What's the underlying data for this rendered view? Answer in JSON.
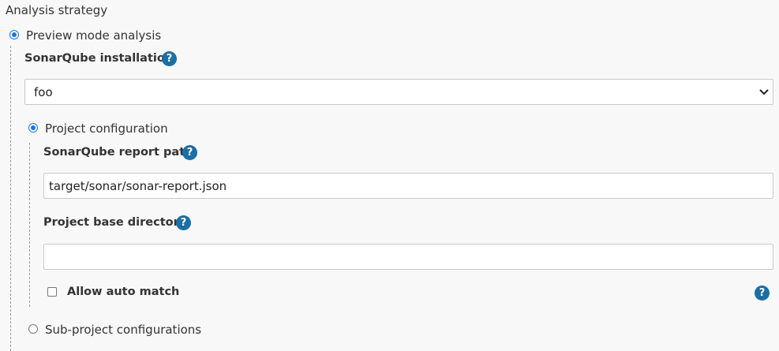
{
  "section_title": "Analysis strategy",
  "preview_mode": {
    "label": "Preview mode analysis",
    "checked": true
  },
  "sonarqube_installation": {
    "label": "SonarQube installation",
    "help": "?",
    "selected": "foo"
  },
  "project_configuration": {
    "label": "Project configuration",
    "checked": true
  },
  "report_path": {
    "label": "SonarQube report path",
    "help": "?",
    "value": "target/sonar/sonar-report.json"
  },
  "base_directory": {
    "label": "Project base directory",
    "help": "?",
    "value": ""
  },
  "auto_match": {
    "label": "Allow auto match",
    "checked": false,
    "help": "?"
  },
  "sub_project": {
    "label": "Sub-project configurations",
    "checked": false
  },
  "colors": {
    "accent": "#1a73e8",
    "help_icon": "#1c6ea4",
    "background": "#f8f8f8"
  }
}
